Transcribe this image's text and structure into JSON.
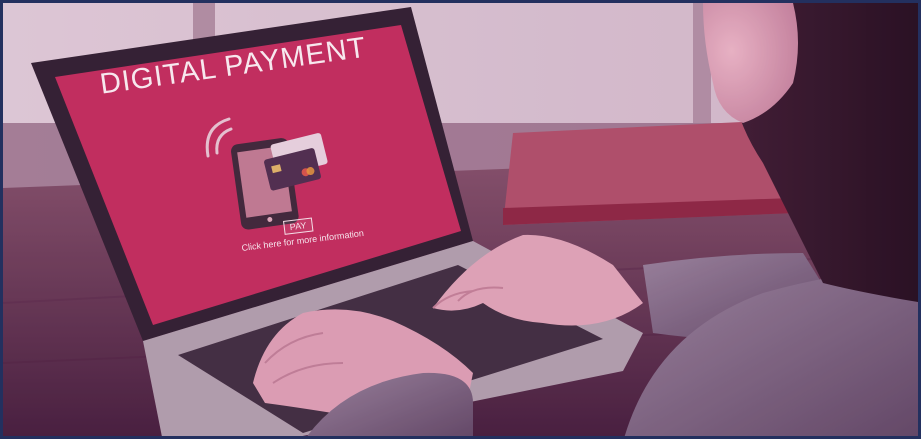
{
  "screen": {
    "headline": "DIGITAL PAYMENT",
    "pay_button": "PAY",
    "info_link": "Click here for more information"
  },
  "colors": {
    "screen_magenta": "#c93060",
    "frame_border": "#23305f",
    "skin": "#e9b3c3",
    "sweater": "#8c7f96"
  },
  "icons": [
    "wifi-icon",
    "phone-icon",
    "credit-card-icon"
  ]
}
